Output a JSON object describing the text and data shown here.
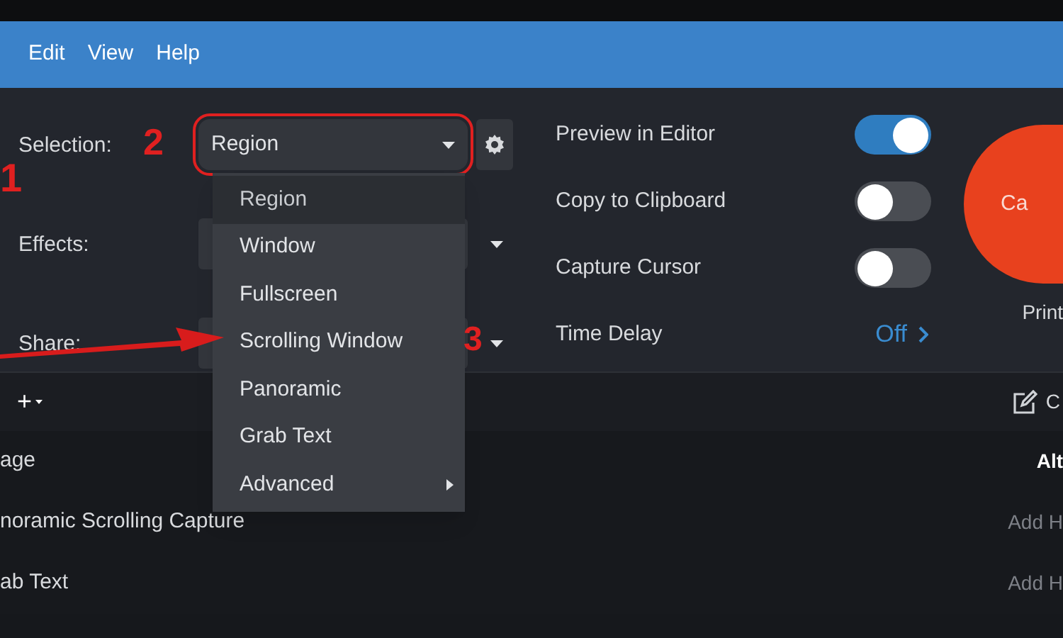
{
  "menu_bar": [
    "Edit",
    "View",
    "Help"
  ],
  "settings": [
    {
      "label": "Selection:",
      "value": "Region"
    },
    {
      "label": "Effects:"
    },
    {
      "label": "Share:"
    }
  ],
  "selection_menu": [
    {
      "label": "Region",
      "selected": true,
      "submenu": false
    },
    {
      "label": "Window",
      "selected": false,
      "submenu": false
    },
    {
      "label": "Fullscreen",
      "selected": false,
      "submenu": false
    },
    {
      "label": "Scrolling Window",
      "selected": false,
      "submenu": false
    },
    {
      "label": "Panoramic",
      "selected": false,
      "submenu": false
    },
    {
      "label": "Grab Text",
      "selected": false,
      "submenu": false
    },
    {
      "label": "Advanced",
      "selected": false,
      "submenu": true
    }
  ],
  "options": [
    {
      "kind": "toggle",
      "label": "Preview in Editor",
      "on": true
    },
    {
      "kind": "toggle",
      "label": "Copy to Clipboard",
      "on": false
    },
    {
      "kind": "toggle",
      "label": "Capture Cursor",
      "on": false
    },
    {
      "kind": "link",
      "label": "Time Delay",
      "value": "Off"
    }
  ],
  "capture_button": {
    "label": "Ca",
    "caption": "Print"
  },
  "toolbar": {
    "add": "+",
    "right": "C"
  },
  "presets": [
    {
      "name": "age",
      "shortcut": "Alt"
    },
    {
      "name": "noramic Scrolling Capture",
      "shortcut": "Add H"
    },
    {
      "name": "ab Text",
      "shortcut": "Add H"
    }
  ],
  "annotations": [
    "1",
    "2",
    "3"
  ]
}
